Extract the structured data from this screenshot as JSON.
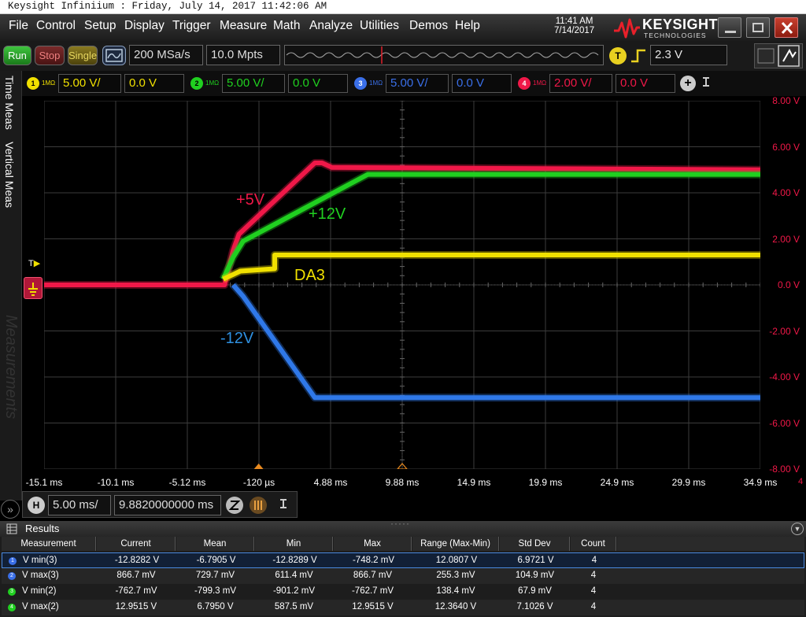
{
  "window": {
    "title": "Keysight Infiniium : Friday, July 14, 2017 11:42:06 AM"
  },
  "menu": {
    "items": [
      "File",
      "Control",
      "Setup",
      "Display",
      "Trigger",
      "Measure",
      "Math",
      "Analyze",
      "Utilities",
      "Demos",
      "Help"
    ],
    "clock_time": "11:41 AM",
    "clock_date": "7/14/2017",
    "brand": "KEYSIGHT",
    "brand_sub": "TECHNOLOGIES"
  },
  "toolbar": {
    "run": "Run",
    "stop": "Stop",
    "single": "Single",
    "sample_rate": "200 MSa/s",
    "memory_depth": "10.0 Mpts",
    "trigger_label": "T",
    "trigger_level": "2.3 V"
  },
  "channels": [
    {
      "num": "1",
      "imp": "1MΩ",
      "scale": "5.00 V/",
      "offset": "0.0 V",
      "color": "#f0e000"
    },
    {
      "num": "2",
      "imp": "1MΩ",
      "scale": "5.00 V/",
      "offset": "0.0 V",
      "color": "#20d020"
    },
    {
      "num": "3",
      "imp": "1MΩ",
      "scale": "5.00 V/",
      "offset": "0.0 V",
      "color": "#3a6fe8"
    },
    {
      "num": "4",
      "imp": "1MΩ",
      "scale": "2.00 V/",
      "offset": "0.0 V",
      "color": "#f01848"
    }
  ],
  "side_tabs": {
    "time_meas": "Time Meas",
    "vertical_meas": "Vertical Meas",
    "measurements": "Measurements"
  },
  "chart_data": {
    "type": "line",
    "x_ticks": [
      "-15.1 ms",
      "-10.1 ms",
      "-5.12 ms",
      "-120 µs",
      "4.88 ms",
      "9.88 ms",
      "14.9 ms",
      "19.9 ms",
      "24.9 ms",
      "29.9 ms",
      "34.9 ms"
    ],
    "y_ticks": [
      "8.00 V",
      "6.00 V",
      "4.00 V",
      "2.00 V",
      "0.0 V",
      "-2.00 V",
      "-4.00 V",
      "-6.00 V",
      "-8.00 V"
    ],
    "xlim": [
      -15.1,
      34.9
    ],
    "ylim": [
      -8,
      8
    ],
    "x_unit": "ms",
    "annotations": [
      {
        "text": "+5V",
        "color": "#f01848"
      },
      {
        "text": "+12V",
        "color": "#20d020"
      },
      {
        "text": "DA3",
        "color": "#f0e000"
      },
      {
        "text": "-12V",
        "color": "#2f90e0"
      }
    ],
    "series": [
      {
        "name": "+5V",
        "color": "#f01848",
        "x": [
          -15.1,
          -2.5,
          -1.9,
          -1.5,
          3.8,
          4.3,
          5.0,
          34.9
        ],
        "y": [
          0.0,
          0.0,
          1.5,
          2.2,
          5.3,
          5.3,
          5.1,
          5.0
        ]
      },
      {
        "name": "+12V",
        "color": "#20d020",
        "x": [
          -2.6,
          -1.9,
          -1.2,
          7.5,
          34.9
        ],
        "y": [
          0.25,
          1.2,
          1.9,
          4.8,
          4.8
        ]
      },
      {
        "name": "DA3",
        "color": "#f0e000",
        "x": [
          -2.6,
          -1.9,
          -1.4,
          1.0,
          1.0,
          34.9
        ],
        "y": [
          0.25,
          0.45,
          0.6,
          0.7,
          1.3,
          1.3
        ]
      },
      {
        "name": "-12V",
        "color": "#2f78e8",
        "x": [
          -1.9,
          -1.2,
          3.8,
          34.9
        ],
        "y": [
          0.0,
          -0.5,
          -4.9,
          -4.9
        ]
      }
    ]
  },
  "horizontal": {
    "label": "H",
    "scale": "5.00 ms/",
    "position": "9.8820000000 ms"
  },
  "results": {
    "title": "Results",
    "columns": [
      "Measurement",
      "Current",
      "Mean",
      "Min",
      "Max",
      "Range (Max-Min)",
      "Std Dev",
      "Count"
    ],
    "rows": [
      {
        "num": "1",
        "color": "#3a6fe8",
        "cells": [
          "V min(3)",
          "-12.8282 V",
          "-6.7905 V",
          "-12.8289 V",
          "-748.2 mV",
          "12.0807 V",
          "6.9721 V",
          "4"
        ]
      },
      {
        "num": "2",
        "color": "#3a6fe8",
        "cells": [
          "V max(3)",
          "866.7 mV",
          "729.7 mV",
          "611.4 mV",
          "866.7 mV",
          "255.3 mV",
          "104.9 mV",
          "4"
        ]
      },
      {
        "num": "3",
        "color": "#20d020",
        "cells": [
          "V min(2)",
          "-762.7 mV",
          "-799.3 mV",
          "-901.2 mV",
          "-762.7 mV",
          "138.4 mV",
          "67.9 mV",
          "4"
        ]
      },
      {
        "num": "4",
        "color": "#20d020",
        "cells": [
          "V max(2)",
          "12.9515 V",
          "6.7950 V",
          "587.5 mV",
          "12.9515 V",
          "12.3640 V",
          "7.1026 V",
          "4"
        ]
      }
    ]
  }
}
